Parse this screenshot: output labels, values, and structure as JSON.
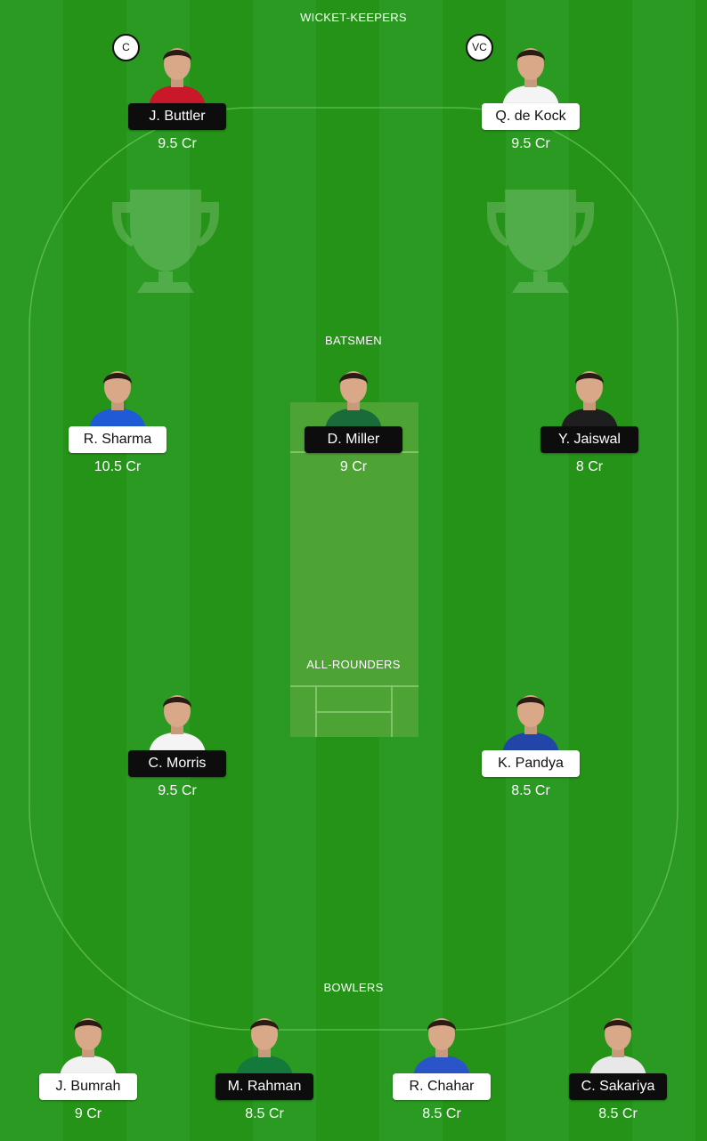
{
  "sections": {
    "wicket_keepers": "WICKET-KEEPERS",
    "batsmen": "BATSMEN",
    "all_rounders": "ALL-ROUNDERS",
    "bowlers": "BOWLERS"
  },
  "colors": {
    "pitch": "#4da435",
    "field_light": "#2a9a22",
    "field_dark": "#259218",
    "pill_dark": "#0d0d0d",
    "pill_light": "#ffffff"
  },
  "players": [
    {
      "name": "J. Buttler",
      "credit": "9.5 Cr",
      "badge": "C",
      "jersey": "#c8182a"
    },
    {
      "name": "Q. de Kock",
      "credit": "9.5 Cr",
      "badge": "VC",
      "jersey": "#f4f4f4"
    },
    {
      "name": "R. Sharma",
      "credit": "10.5 Cr",
      "jersey": "#1f5bd6"
    },
    {
      "name": "D. Miller",
      "credit": "9 Cr",
      "jersey": "#1a6b3a"
    },
    {
      "name": "Y. Jaiswal",
      "credit": "8 Cr",
      "jersey": "#1e1e1e"
    },
    {
      "name": "C. Morris",
      "credit": "9.5 Cr",
      "jersey": "#f4f4f4"
    },
    {
      "name": "K. Pandya",
      "credit": "8.5 Cr",
      "jersey": "#2245a8"
    },
    {
      "name": "J. Bumrah",
      "credit": "9 Cr",
      "jersey": "#f2f2f2"
    },
    {
      "name": "M. Rahman",
      "credit": "8.5 Cr",
      "jersey": "#137a3c"
    },
    {
      "name": "R. Chahar",
      "credit": "8.5 Cr",
      "jersey": "#2a55c8"
    },
    {
      "name": "C. Sakariya",
      "credit": "8.5 Cr",
      "jersey": "#e8e8e8"
    }
  ]
}
